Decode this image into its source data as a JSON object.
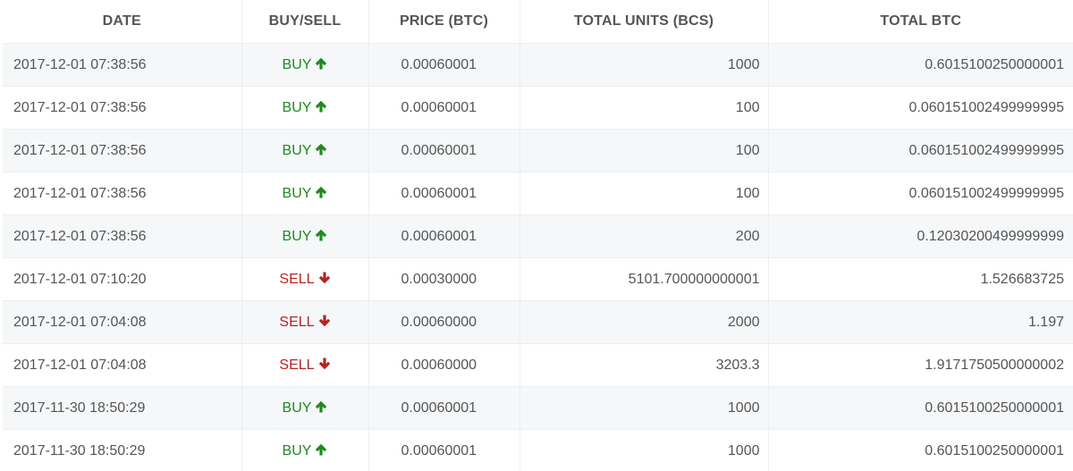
{
  "table": {
    "headers": [
      "DATE",
      "BUY/SELL",
      "PRICE (BTC)",
      "TOTAL UNITS (BCS)",
      "TOTAL BTC"
    ],
    "colors": {
      "buy": "#1e8a1e",
      "sell": "#b32424"
    },
    "rows": [
      {
        "date": "2017-12-01 07:38:56",
        "side": "BUY",
        "icon": "arrow-up-icon",
        "price": "0.00060001",
        "units": "1000",
        "total": "0.6015100250000001"
      },
      {
        "date": "2017-12-01 07:38:56",
        "side": "BUY",
        "icon": "arrow-up-icon",
        "price": "0.00060001",
        "units": "100",
        "total": "0.060151002499999995"
      },
      {
        "date": "2017-12-01 07:38:56",
        "side": "BUY",
        "icon": "arrow-up-icon",
        "price": "0.00060001",
        "units": "100",
        "total": "0.060151002499999995"
      },
      {
        "date": "2017-12-01 07:38:56",
        "side": "BUY",
        "icon": "arrow-up-icon",
        "price": "0.00060001",
        "units": "100",
        "total": "0.060151002499999995"
      },
      {
        "date": "2017-12-01 07:38:56",
        "side": "BUY",
        "icon": "arrow-up-icon",
        "price": "0.00060001",
        "units": "200",
        "total": "0.12030200499999999"
      },
      {
        "date": "2017-12-01 07:10:20",
        "side": "SELL",
        "icon": "arrow-down-icon",
        "price": "0.00030000",
        "units": "5101.700000000001",
        "total": "1.526683725"
      },
      {
        "date": "2017-12-01 07:04:08",
        "side": "SELL",
        "icon": "arrow-down-icon",
        "price": "0.00060000",
        "units": "2000",
        "total": "1.197"
      },
      {
        "date": "2017-12-01 07:04:08",
        "side": "SELL",
        "icon": "arrow-down-icon",
        "price": "0.00060000",
        "units": "3203.3",
        "total": "1.9171750500000002"
      },
      {
        "date": "2017-11-30 18:50:29",
        "side": "BUY",
        "icon": "arrow-up-icon",
        "price": "0.00060001",
        "units": "1000",
        "total": "0.6015100250000001"
      },
      {
        "date": "2017-11-30 18:50:29",
        "side": "BUY",
        "icon": "arrow-up-icon",
        "price": "0.00060001",
        "units": "1000",
        "total": "0.6015100250000001"
      }
    ]
  }
}
